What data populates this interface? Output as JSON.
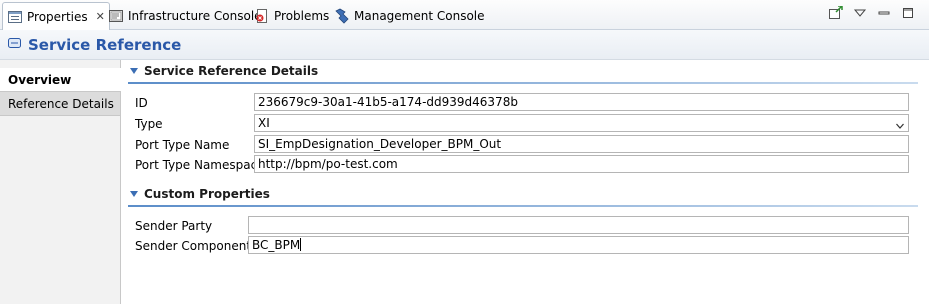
{
  "tabs": [
    {
      "label": "Properties",
      "icon": "properties-icon",
      "active": true
    },
    {
      "label": "Infrastructure Console",
      "icon": "console-icon"
    },
    {
      "label": "Problems",
      "icon": "problems-icon"
    },
    {
      "label": "Management Console",
      "icon": "management-icon"
    }
  ],
  "header": {
    "title": "Service Reference"
  },
  "nav": {
    "items": [
      {
        "label": "Overview"
      },
      {
        "label": "Reference Details"
      }
    ]
  },
  "details": {
    "heading": "Service Reference Details",
    "id_label": "ID",
    "id_value": "236679c9-30a1-41b5-a174-dd939d46378b",
    "type_label": "Type",
    "type_value": "XI",
    "port_type_name_label": "Port Type Name",
    "port_type_name_value": "SI_EmpDesignation_Developer_BPM_Out",
    "port_type_ns_label": "Port Type Namespace",
    "port_type_ns_value": "http://bpm/po-test.com"
  },
  "custom": {
    "heading": "Custom Properties",
    "sender_party_label": "Sender Party",
    "sender_party_value": "",
    "sender_component_label": "Sender Component",
    "sender_component_value": "BC_BPM"
  },
  "colors": {
    "accent": "#2a58a8",
    "section_line": "#5b8dc9"
  }
}
